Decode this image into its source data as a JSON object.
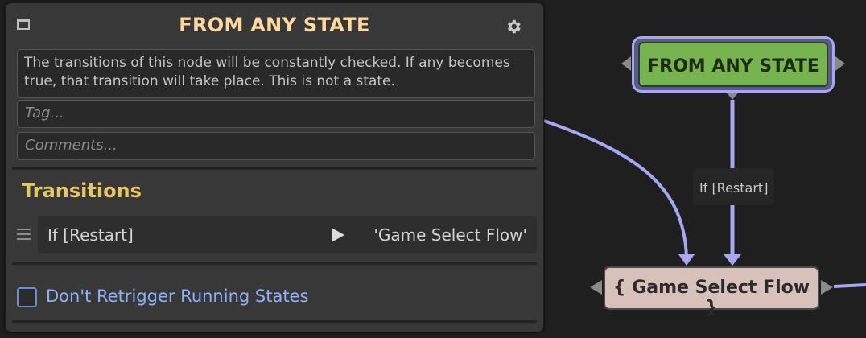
{
  "panel": {
    "title": "FROM ANY STATE",
    "description": "The transitions of this node will be constantly checked. If any becomes true, that transition will take place. This is not a state.",
    "tag_placeholder": "Tag...",
    "comments_placeholder": "Comments...",
    "transitions_title": "Transitions",
    "transitions": [
      {
        "condition": "If [Restart]",
        "target": "'Game Select Flow'"
      }
    ],
    "retrigger_label": "Don't Retrigger Running States",
    "retrigger_checked": false
  },
  "graph": {
    "any_state_node": {
      "label": "FROM ANY STATE"
    },
    "target_node": {
      "label": "{ Game Select Flow }"
    },
    "edge_label": "If [Restart]"
  },
  "colors": {
    "accent_title": "#ffd9a0",
    "section_title": "#e6c765",
    "link_blue": "#8db2f5",
    "edge": "#a7a6f2",
    "node_green": "#76b54e",
    "node_target": "#d8c0bb"
  },
  "icons": [
    "window-icon",
    "gear-icon",
    "drag-handle-icon",
    "play-icon",
    "checkbox-icon"
  ]
}
